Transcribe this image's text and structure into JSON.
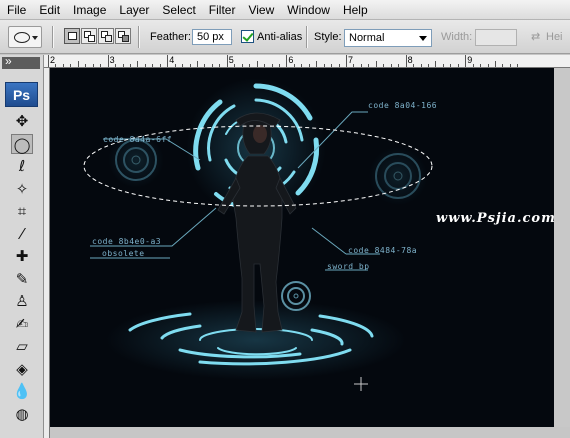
{
  "menu": [
    "File",
    "Edit",
    "Image",
    "Layer",
    "Select",
    "Filter",
    "View",
    "Window",
    "Help"
  ],
  "options": {
    "feather_label": "Feather:",
    "feather_value": "50 px",
    "antialias_label": "Anti-alias",
    "antialias_checked": true,
    "style_label": "Style:",
    "style_value": "Normal",
    "width_label": "Width:",
    "width_value": "",
    "height_label": "Hei",
    "swap_icon": "swap-arrows-icon"
  },
  "toolbox": {
    "logo": "Ps",
    "tools": [
      {
        "name": "move-tool-icon",
        "glyph": "✥",
        "active": false
      },
      {
        "name": "elliptical-marquee-tool-icon",
        "glyph": "◯",
        "active": true
      },
      {
        "name": "lasso-tool-icon",
        "glyph": "ℓ",
        "active": false
      },
      {
        "name": "magic-wand-tool-icon",
        "glyph": "✧",
        "active": false
      },
      {
        "name": "crop-tool-icon",
        "glyph": "⌗",
        "active": false
      },
      {
        "name": "eyedropper-tool-icon",
        "glyph": "⁄",
        "active": false
      },
      {
        "name": "healing-brush-tool-icon",
        "glyph": "✚",
        "active": false
      },
      {
        "name": "brush-tool-icon",
        "glyph": "✎",
        "active": false
      },
      {
        "name": "clone-stamp-tool-icon",
        "glyph": "♙",
        "active": false
      },
      {
        "name": "history-brush-tool-icon",
        "glyph": "✍",
        "active": false
      },
      {
        "name": "eraser-tool-icon",
        "glyph": "▱",
        "active": false
      },
      {
        "name": "paint-bucket-tool-icon",
        "glyph": "◈",
        "active": false
      },
      {
        "name": "blur-tool-icon",
        "glyph": "💧",
        "active": false
      },
      {
        "name": "dodge-tool-icon",
        "glyph": "◍",
        "active": false
      }
    ]
  },
  "ruler": {
    "ticks": [
      "2",
      "3",
      "4",
      "5",
      "6",
      "7",
      "8",
      "9"
    ]
  },
  "canvas": {
    "labels": {
      "code_top_right": "code 8a04-166",
      "code_left_top": "code 8a4a-6ff",
      "code_left_mid": "code 8b4e0-a3",
      "obsolete": "obsolete",
      "code_right_mid": "code 8484-78a",
      "sword": "sword bp"
    },
    "watermark": "www.Psjia.com"
  }
}
